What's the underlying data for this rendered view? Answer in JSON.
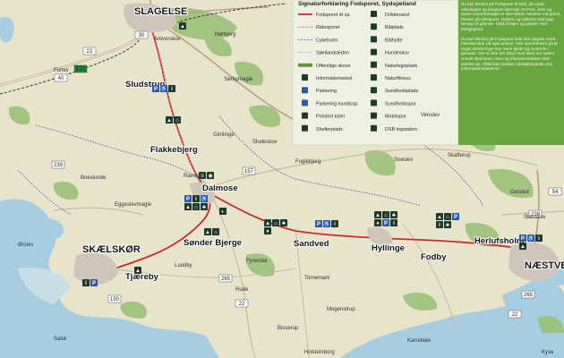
{
  "map": {
    "title": "Signaturforklaring Fodsporet, Sydsjælland",
    "towns": [
      {
        "id": "slagelse",
        "label": "SLAGELSE"
      },
      {
        "id": "sludstrup",
        "label": "Sludstrup"
      },
      {
        "id": "flakkebjerg",
        "label": "Flakkebjerg"
      },
      {
        "id": "dalmose",
        "label": "Dalmose"
      },
      {
        "id": "skaelskor",
        "label": "SKÆLSKØR"
      },
      {
        "id": "sonderbjerge",
        "label": "Sønder Bjerge"
      },
      {
        "id": "tjaereby",
        "label": "Tjæreby"
      },
      {
        "id": "sandved",
        "label": "Sandved"
      },
      {
        "id": "hyllinge",
        "label": "Hyllinge"
      },
      {
        "id": "fodby",
        "label": "Fodby"
      },
      {
        "id": "herlufsholm",
        "label": "Herlufsholm"
      },
      {
        "id": "naestved",
        "label": "NÆSTVED"
      }
    ],
    "small_places": [
      "Antvorskov",
      "Nørbjerg",
      "Forlev",
      "Sørbymagle",
      "Ravnstrup",
      "Sludeskov",
      "Gimlinge",
      "Boeslunde",
      "Eggeslevmagle",
      "Lundby",
      "Rude",
      "Fyrendal",
      "Tornemark",
      "Mogenstrup",
      "Gelsted",
      "Karrebæk",
      "Saltø",
      "Bisserup",
      "Ørslev",
      "Fuglebjerg",
      "Sneslev",
      "Holsteinborg",
      "Kyse",
      "Venslev",
      "Skafterup",
      "Stenskov"
    ],
    "road_numbers": [
      "30",
      "22",
      "E20",
      "40",
      "265",
      "239",
      "157",
      "150",
      "22",
      "54",
      "239",
      "265",
      "22"
    ],
    "trail_name": "Fodsporet"
  },
  "legend": {
    "items": [
      {
        "label": "Fodsporet ét sp",
        "icon": "red-line"
      },
      {
        "label": "Ridesporet",
        "icon": "dotted-line"
      },
      {
        "label": "Cykelruter",
        "icon": "dashed-line"
      },
      {
        "label": "Sjællandsleden",
        "icon": "dot-line"
      },
      {
        "label": "Offentlige skove",
        "icon": "green-bar"
      },
      {
        "label": "Informationssted",
        "icon": "info-icon"
      },
      {
        "label": "Parkering",
        "icon": "parking-icon"
      },
      {
        "label": "Parkering handicap",
        "icon": "handicap-icon"
      },
      {
        "label": "Primitivt toilet",
        "icon": "toilet-icon"
      },
      {
        "label": "Shelterplads",
        "icon": "shelter-icon"
      },
      {
        "label": "Drikkevand",
        "icon": "water-icon"
      },
      {
        "label": "Bålplads",
        "icon": "fire-icon"
      },
      {
        "label": "Bålhytte",
        "icon": "hut-icon"
      },
      {
        "label": "Hundeskov",
        "icon": "dog-icon"
      },
      {
        "label": "Naturlegeplads",
        "icon": "play-icon"
      },
      {
        "label": "Naturfitness",
        "icon": "fitness-icon"
      },
      {
        "label": "Sundhedsplads",
        "icon": "health-icon"
      },
      {
        "label": "Sundhedsspor",
        "icon": "health-trail-icon"
      },
      {
        "label": "Motelspot",
        "icon": "spot-icon"
      },
      {
        "label": "DSB togstation",
        "icon": "train-icon"
      }
    ]
  },
  "info_panel": {
    "para1": "Du kan færdes på Fodsporet til fods, på cykel, rulleskøjter og langsom kørende ATV'ere. Stier og andre motorkøretøjer er ikke tilladt. Hestene må gerne færdes på ridesporet. Ryttere og cyklister skal tage hensyn til gående. Hold til højre og passér med forsigtighed.",
    "para2": "Du kan færdes på Fodsporet hele året døgnet rundt. Færdsel sker på eget ansvar. Vær opmærksom på at nogle strækninger kan være glatte og mudrede i perioder. Der er ikke ført tilsyn med stien om natten. Hunde skal føres i snor og efterladenskaber skal samles op. Affald kan smides i skraldespande ved informationsstederne."
  }
}
